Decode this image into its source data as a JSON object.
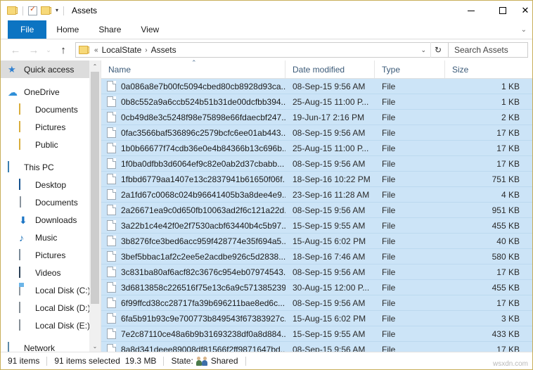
{
  "window": {
    "title": "Assets",
    "quick_access_toolbar": [
      {
        "icon": "folder-icon",
        "name": "properties-folder-icon"
      },
      {
        "icon": "properties-icon",
        "name": "properties-icon"
      },
      {
        "icon": "new-folder-icon",
        "name": "new-folder-icon"
      }
    ],
    "controls": {
      "minimize": "–",
      "maximize": "□",
      "close": "✕"
    }
  },
  "ribbon": {
    "tabs": [
      {
        "label": "File",
        "active": true
      },
      {
        "label": "Home",
        "active": false
      },
      {
        "label": "Share",
        "active": false
      },
      {
        "label": "View",
        "active": false
      }
    ],
    "collapse_chevron": "⌄"
  },
  "address_bar": {
    "back": "←",
    "forward": "→",
    "recent": "⌄",
    "up": "↑",
    "separator_prefix": "«",
    "crumbs": [
      "LocalState",
      "Assets"
    ],
    "crumb_separator": "›",
    "dropdown": "⌄",
    "refresh": "↻",
    "search_placeholder": "Search Assets"
  },
  "sidebar": {
    "items": [
      {
        "label": "Quick access",
        "icon": "pin-star-icon",
        "indent": 0,
        "selected": true,
        "gap": false
      },
      {
        "label": "OneDrive",
        "icon": "cloud-icon",
        "indent": 0,
        "selected": false,
        "gap": true
      },
      {
        "label": "Documents",
        "icon": "folder-icon",
        "indent": 1,
        "selected": false,
        "gap": false
      },
      {
        "label": "Pictures",
        "icon": "folder-icon",
        "indent": 1,
        "selected": false,
        "gap": false
      },
      {
        "label": "Public",
        "icon": "folder-icon",
        "indent": 1,
        "selected": false,
        "gap": false
      },
      {
        "label": "This PC",
        "icon": "computer-icon",
        "indent": 0,
        "selected": false,
        "gap": true
      },
      {
        "label": "Desktop",
        "icon": "desktop-icon",
        "indent": 1,
        "selected": false,
        "gap": false
      },
      {
        "label": "Documents",
        "icon": "documents-icon",
        "indent": 1,
        "selected": false,
        "gap": false
      },
      {
        "label": "Downloads",
        "icon": "download-arrow-icon",
        "indent": 1,
        "selected": false,
        "gap": false
      },
      {
        "label": "Music",
        "icon": "music-note-icon",
        "indent": 1,
        "selected": false,
        "gap": false
      },
      {
        "label": "Pictures",
        "icon": "picture-icon",
        "indent": 1,
        "selected": false,
        "gap": false
      },
      {
        "label": "Videos",
        "icon": "video-icon",
        "indent": 1,
        "selected": false,
        "gap": false
      },
      {
        "label": "Local Disk (C:)",
        "icon": "system-drive-icon",
        "indent": 1,
        "selected": false,
        "gap": false
      },
      {
        "label": "Local Disk (D:)",
        "icon": "drive-icon",
        "indent": 1,
        "selected": false,
        "gap": false
      },
      {
        "label": "Local Disk (E:)",
        "icon": "drive-icon",
        "indent": 1,
        "selected": false,
        "gap": false
      },
      {
        "label": "Network",
        "icon": "network-icon",
        "indent": 0,
        "selected": false,
        "gap": true
      }
    ],
    "scroll_up": "⌃",
    "scroll_down": "⌄"
  },
  "file_list": {
    "columns": [
      "Name",
      "Date modified",
      "Type",
      "Size"
    ],
    "sort_column": "Name",
    "sort_indicator": "⌃",
    "rows": [
      {
        "name": "0a086a8e7b00fc5094cbed80cb8928d93ca...",
        "date": "08-Sep-15 9:56 AM",
        "type": "File",
        "size": "1 KB"
      },
      {
        "name": "0b8c552a9a6ccb524b51b31de00dcfbb394...",
        "date": "25-Aug-15 11:00 P...",
        "type": "File",
        "size": "1 KB"
      },
      {
        "name": "0cb49d8e3c5248f98e75898e66fdaecbf247...",
        "date": "19-Jun-17 2:16 PM",
        "type": "File",
        "size": "2 KB"
      },
      {
        "name": "0fac3566baf536896c2579bcfc6ee01ab443...",
        "date": "08-Sep-15 9:56 AM",
        "type": "File",
        "size": "17 KB"
      },
      {
        "name": "1b0b66677f74cdb36e0e4b84366b13c696b...",
        "date": "25-Aug-15 11:00 P...",
        "type": "File",
        "size": "17 KB"
      },
      {
        "name": "1f0ba0dfbb3d6064ef9c82e0ab2d37cbabb...",
        "date": "08-Sep-15 9:56 AM",
        "type": "File",
        "size": "17 KB"
      },
      {
        "name": "1fbbd6779aa1407e13c2837941b61650f06f...",
        "date": "18-Sep-16 10:22 PM",
        "type": "File",
        "size": "751 KB"
      },
      {
        "name": "2a1fd67c0068c024b96641405b3a8dee4e9...",
        "date": "23-Sep-16 11:28 AM",
        "type": "File",
        "size": "4 KB"
      },
      {
        "name": "2a26671ea9c0d650fb10063ad2f6c121a22d...",
        "date": "08-Sep-15 9:56 AM",
        "type": "File",
        "size": "951 KB"
      },
      {
        "name": "3a22b1c4e42f0e2f7530acbf63440b4c5b97...",
        "date": "15-Sep-15 9:55 AM",
        "type": "File",
        "size": "455 KB"
      },
      {
        "name": "3b8276fce3bed6acc959f428774e35f694a5...",
        "date": "15-Aug-15 6:02 PM",
        "type": "File",
        "size": "40 KB"
      },
      {
        "name": "3bef5bbac1af2c2ee5e2acdbe926c5d2838...",
        "date": "18-Sep-16 7:46 AM",
        "type": "File",
        "size": "580 KB"
      },
      {
        "name": "3c831ba80af6acf82c3676c954eb07974543...",
        "date": "08-Sep-15 9:56 AM",
        "type": "File",
        "size": "17 KB"
      },
      {
        "name": "3d6813858c226516f75e13c6a9c571385239...",
        "date": "30-Aug-15 12:00 P...",
        "type": "File",
        "size": "455 KB"
      },
      {
        "name": "6f99ffcd38cc28717fa39b696211bae8ed6c...",
        "date": "08-Sep-15 9:56 AM",
        "type": "File",
        "size": "17 KB"
      },
      {
        "name": "6fa5b91b93c9e700773b849543f67383927c...",
        "date": "15-Aug-15 6:02 PM",
        "type": "File",
        "size": "3 KB"
      },
      {
        "name": "7e2c87110ce48a6b9b31693238df0a8d884...",
        "date": "15-Sep-15 9:55 AM",
        "type": "File",
        "size": "433 KB"
      },
      {
        "name": "8a8d341deee89008df81566f2ff9871647bd...",
        "date": "08-Sep-15 9:56 AM",
        "type": "File",
        "size": "17 KB"
      }
    ]
  },
  "status_bar": {
    "item_count": "91 items",
    "selection": "91 items selected",
    "selection_size": "19.3 MB",
    "state_label": "State:",
    "state_value": "Shared"
  },
  "watermark": "wsxdn.com"
}
